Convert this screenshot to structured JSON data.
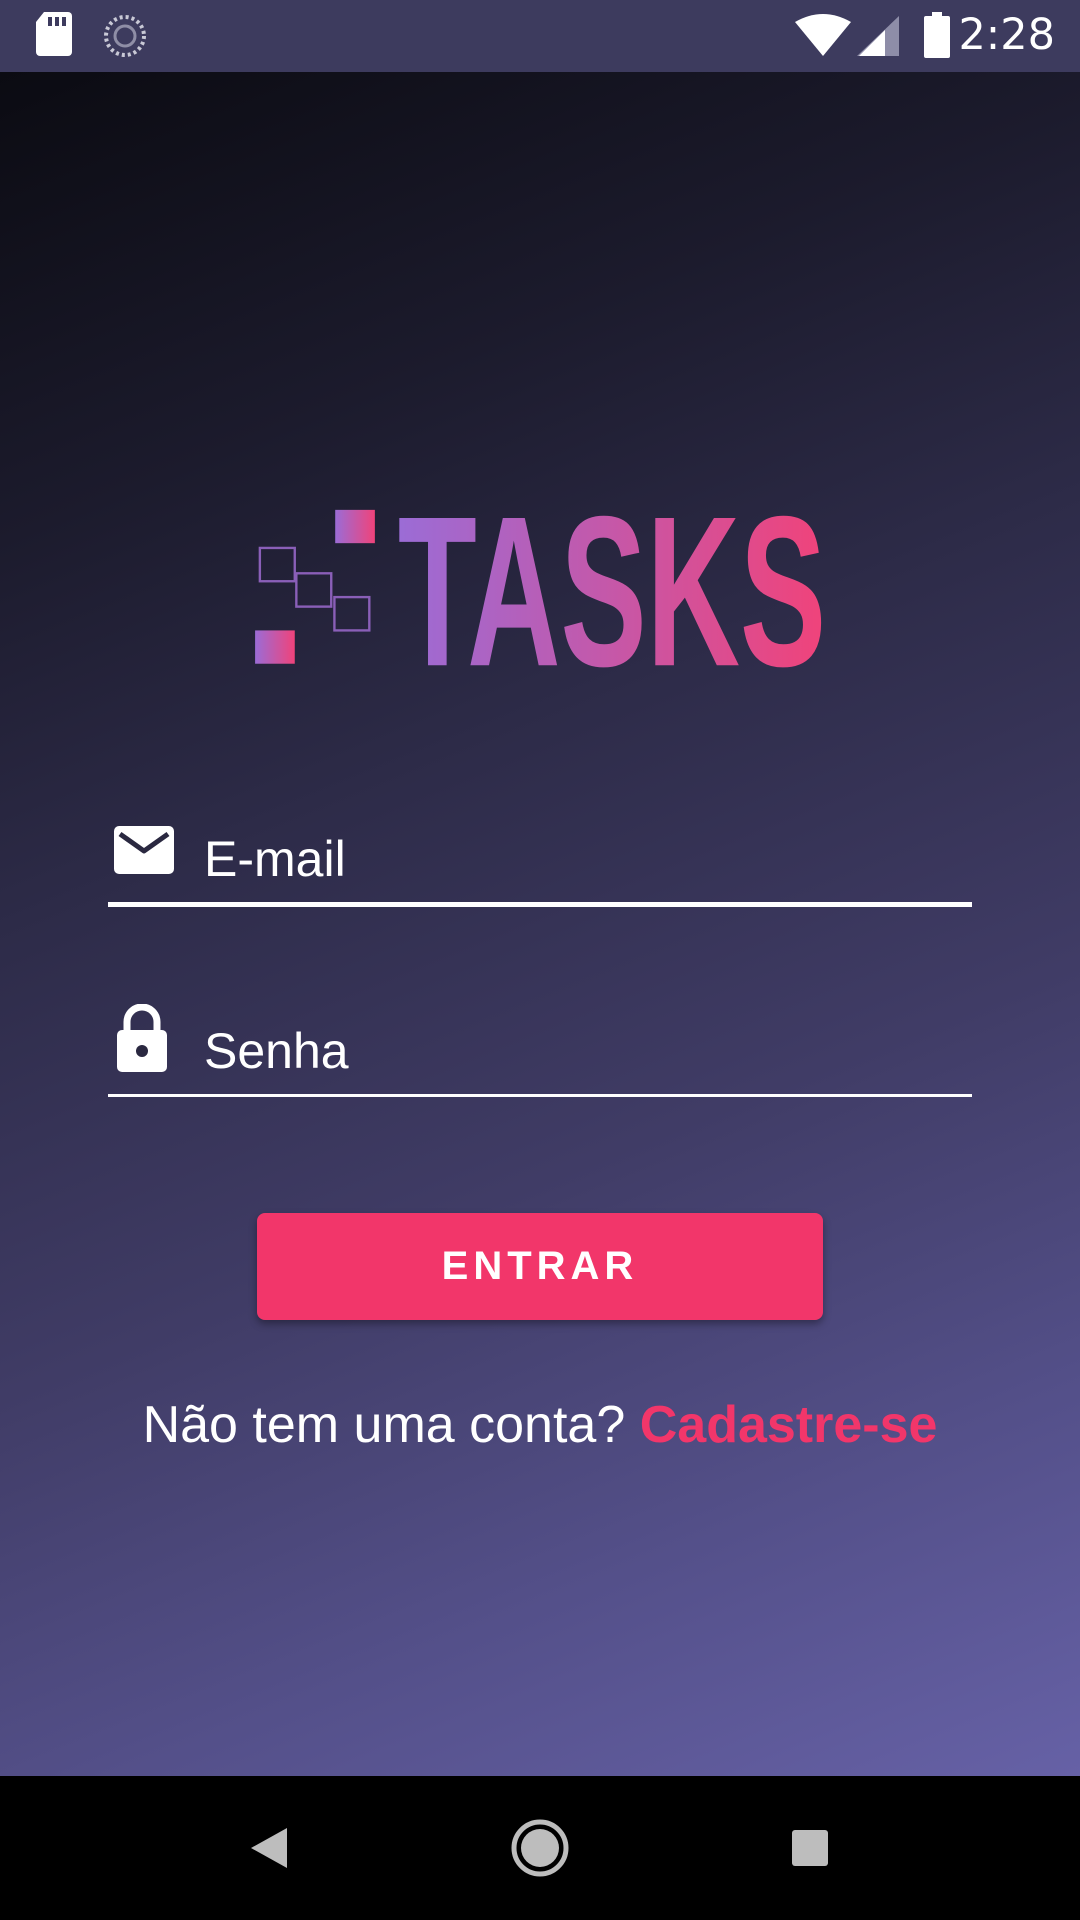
{
  "status_bar": {
    "time": "2:28",
    "icons": [
      "sd-card-icon",
      "sync-icon",
      "wifi-icon",
      "cell-signal-icon",
      "battery-icon"
    ]
  },
  "logo": {
    "text": "TASKS",
    "gradient_start": "#9b6cd6",
    "gradient_end": "#f0437a"
  },
  "form": {
    "email_placeholder": "E-mail",
    "password_placeholder": "Senha",
    "submit_label": "ENTRAR"
  },
  "signup": {
    "prompt": "Não tem uma conta? ",
    "link": "Cadastre-se"
  },
  "nav_bar": {
    "buttons": [
      "back-icon",
      "home-icon",
      "recents-icon"
    ]
  },
  "colors": {
    "accent": "#f2366a",
    "status_bar": "#3d3b5e",
    "background_start": "#0b0b12",
    "background_end": "#6661a6"
  }
}
